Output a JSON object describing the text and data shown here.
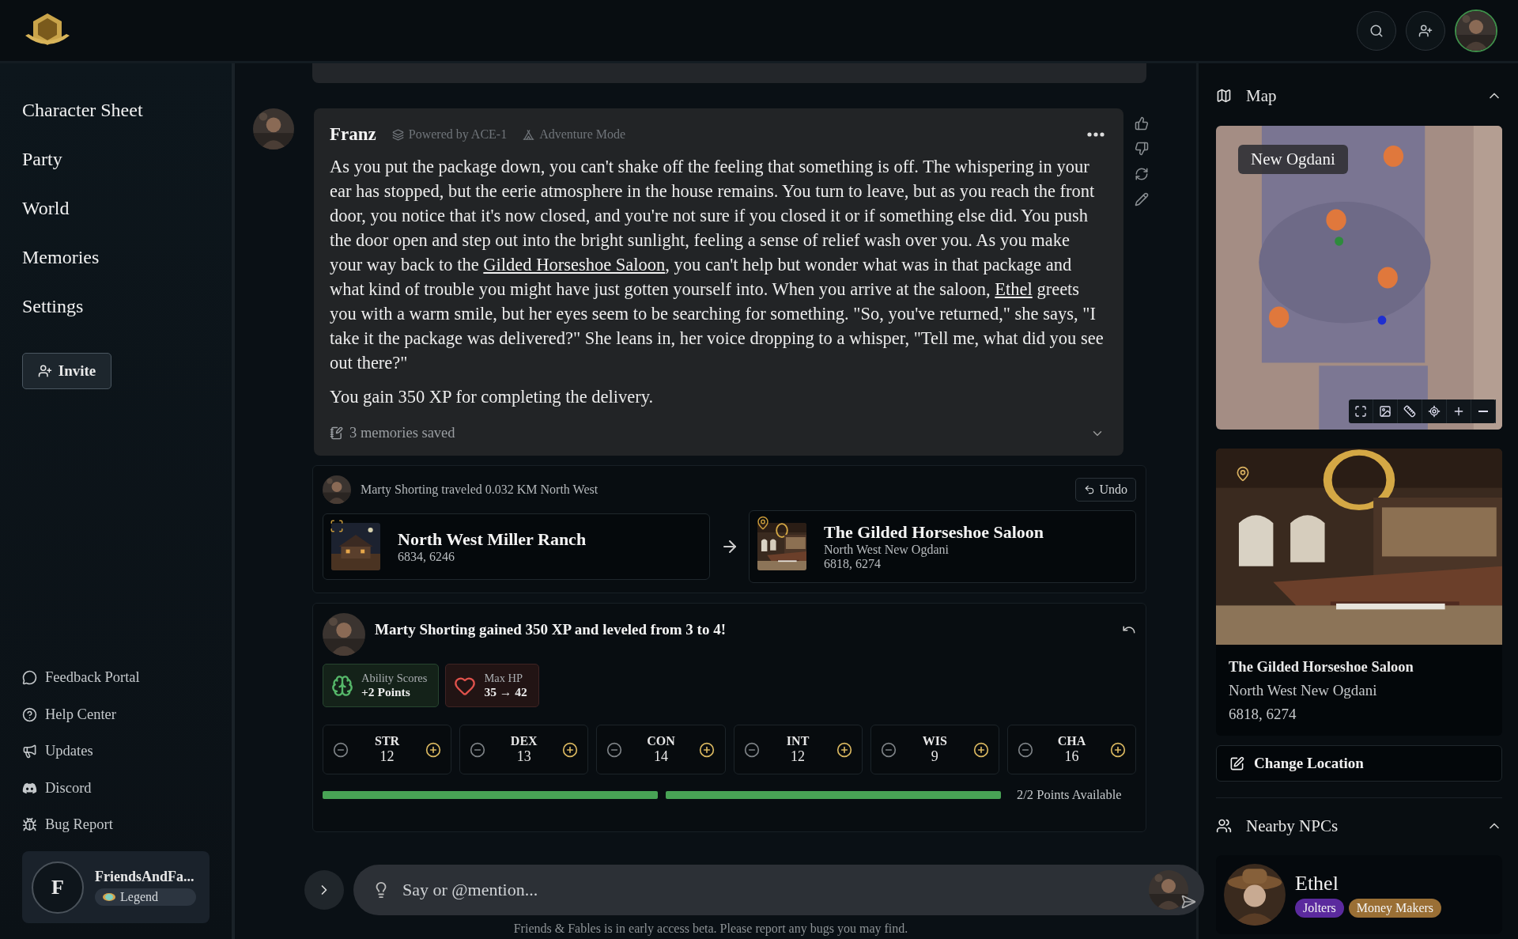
{
  "nav": {
    "items": [
      {
        "label": "Character Sheet"
      },
      {
        "label": "Party"
      },
      {
        "label": "World"
      },
      {
        "label": "Memories"
      },
      {
        "label": "Settings"
      }
    ],
    "invite": "Invite"
  },
  "links": [
    {
      "kind": "feedback",
      "label": "Feedback Portal"
    },
    {
      "kind": "help",
      "label": "Help Center"
    },
    {
      "kind": "updates",
      "label": "Updates"
    },
    {
      "kind": "discord",
      "label": "Discord"
    },
    {
      "kind": "bug",
      "label": "Bug Report"
    }
  ],
  "user": {
    "initial": "F",
    "name": "FriendsAndFa...",
    "rank": "Legend"
  },
  "message": {
    "author": "Franz",
    "model": "Powered by ACE-1",
    "mode": "Adventure Mode",
    "paragraphs": [
      [
        {
          "kind": "text",
          "text": "As you put the package down, you can't shake off the feeling that something is off. The whispering in your ear has stopped, but the eerie atmosphere in the house remains. You turn to leave, but as you reach the front door, you notice that it's now closed, and you're not sure if you closed it or if something else did. You push the door open and step out into the bright sunlight, feeling a sense of relief wash over you. As you make your way back to the "
        },
        {
          "kind": "link",
          "text": "Gilded Horseshoe Saloon"
        },
        {
          "kind": "text",
          "text": ", you can't help but wonder what was in that package and what kind of trouble you might have just gotten yourself into. When you arrive at the saloon, "
        },
        {
          "kind": "link",
          "text": "Ethel"
        },
        {
          "kind": "text",
          "text": " greets you with a warm smile, but her eyes seem to be searching for something. \"So, you've returned,\" she says, \"I take it the package was delivered?\" She leans in, her voice dropping to a whisper, \"Tell me, what did you see out there?\""
        }
      ],
      [
        {
          "kind": "text",
          "text": "You gain 350 XP for completing the delivery."
        }
      ]
    ],
    "memories": "3 memories saved"
  },
  "travel": {
    "text": "Marty Shorting traveled 0.032 KM North West",
    "undo": "Undo",
    "from": {
      "name": "North West Miller Ranch",
      "coords": "6834, 6246"
    },
    "to": {
      "name": "The Gilded Horseshoe Saloon",
      "region": "North West New Ogdani",
      "coords": "6818, 6274"
    }
  },
  "levelup": {
    "title": "Marty Shorting gained 350 XP and leveled from 3 to 4!",
    "rewards": [
      {
        "kind": "ability",
        "label": "Ability Scores",
        "value": "+2 Points"
      },
      {
        "kind": "hp",
        "label": "Max HP",
        "value": "35 → 42"
      }
    ],
    "stats": [
      {
        "name": "STR",
        "value": "12"
      },
      {
        "name": "DEX",
        "value": "13"
      },
      {
        "name": "CON",
        "value": "14"
      },
      {
        "name": "INT",
        "value": "12"
      },
      {
        "name": "WIS",
        "value": "9"
      },
      {
        "name": "CHA",
        "value": "16"
      }
    ],
    "points": [
      {
        "level": 1
      },
      {
        "level": 1
      }
    ],
    "points_text": "2/2 Points Available"
  },
  "input": {
    "placeholder": "Say or @mention..."
  },
  "footer": "Friends & Fables is in early access beta. Please report any bugs you may find.",
  "map": {
    "title": "Map",
    "expanded": true,
    "city_label": "New Ogdani"
  },
  "location": {
    "name": "The Gilded Horseshoe Saloon",
    "region": "North West New Ogdani",
    "coords": "6818, 6274",
    "button": "Change Location"
  },
  "npcs": {
    "title": "Nearby NPCs",
    "expanded": true,
    "items": [
      {
        "name": "Ethel",
        "tags": [
          {
            "label": "Jolters",
            "color": "#5b2a9e"
          },
          {
            "label": "Money Makers",
            "color": "#9a6f35"
          }
        ]
      }
    ]
  }
}
